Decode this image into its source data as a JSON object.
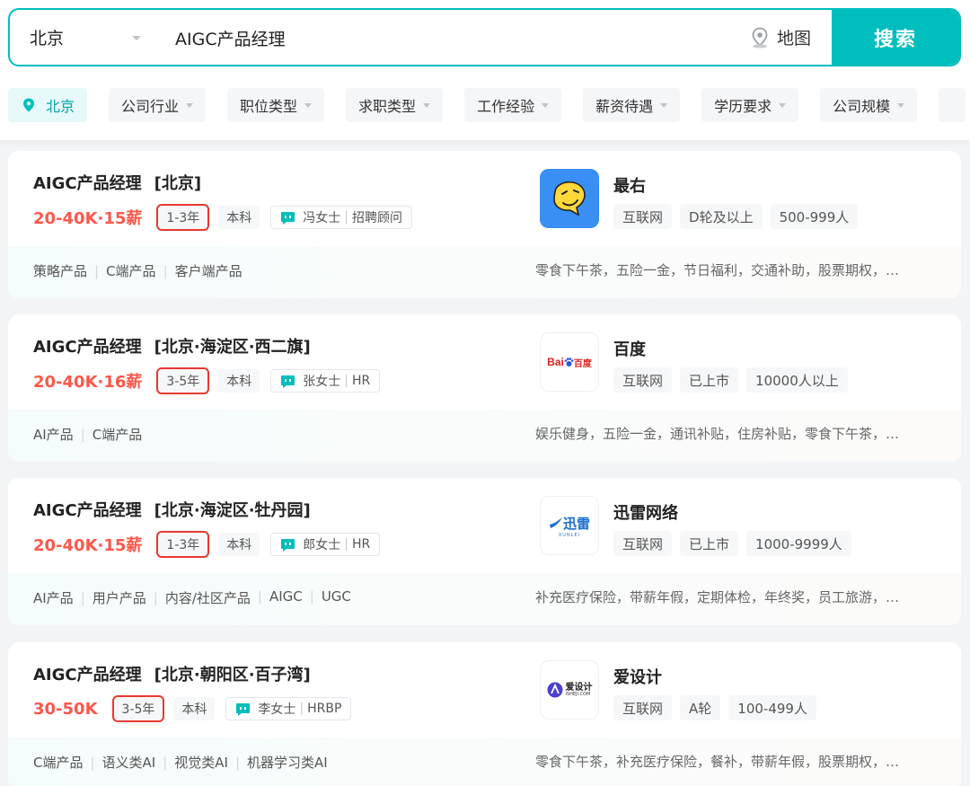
{
  "search": {
    "city": "北京",
    "query": "AIGC产品经理",
    "map_label": "地图",
    "search_button": "搜索"
  },
  "filters": {
    "city": "北京",
    "items": [
      "公司行业",
      "职位类型",
      "求职类型",
      "工作经验",
      "薪资待遇",
      "学历要求",
      "公司规模"
    ]
  },
  "jobs": [
    {
      "title": "AIGC产品经理",
      "location": "[北京]",
      "salary": "20-40K·15薪",
      "experience": "1-3年",
      "education": "本科",
      "recruiter": "冯女士",
      "recruiter_role": "招聘顾问",
      "company": "最右",
      "company_tags": [
        "互联网",
        "D轮及以上",
        "500-999人"
      ],
      "skills": [
        "策略产品",
        "C端产品",
        "客户端产品"
      ],
      "benefits": "零食下午茶，五险一金，节日福利，交通补助，股票期权，…",
      "logo": "zuiyou-logo"
    },
    {
      "title": "AIGC产品经理",
      "location": "[北京·海淀区·西二旗]",
      "salary": "20-40K·16薪",
      "experience": "3-5年",
      "education": "本科",
      "recruiter": "张女士",
      "recruiter_role": "HR",
      "company": "百度",
      "company_tags": [
        "互联网",
        "已上市",
        "10000人以上"
      ],
      "skills": [
        "AI产品",
        "C端产品"
      ],
      "benefits": "娱乐健身，五险一金，通讯补贴，住房补贴，零食下午茶，…",
      "logo": "baidu-logo",
      "logo_text": [
        "Bai",
        "百度"
      ]
    },
    {
      "title": "AIGC产品经理",
      "location": "[北京·海淀区·牡丹园]",
      "salary": "20-40K·15薪",
      "experience": "1-3年",
      "education": "本科",
      "recruiter": "郎女士",
      "recruiter_role": "HR",
      "company": "迅雷网络",
      "company_tags": [
        "互联网",
        "已上市",
        "1000-9999人"
      ],
      "skills": [
        "AI产品",
        "用户产品",
        "内容/社区产品",
        "AIGC",
        "UGC"
      ],
      "benefits": "补充医疗保险，带薪年假，定期体检，年终奖，员工旅游，…",
      "logo": "xunlei-logo",
      "logo_text": [
        "迅雷",
        "XUNLEI"
      ]
    },
    {
      "title": "AIGC产品经理",
      "location": "[北京·朝阳区·百子湾]",
      "salary": "30-50K",
      "experience": "3-5年",
      "education": "本科",
      "recruiter": "李女士",
      "recruiter_role": "HRBP",
      "company": "爱设计",
      "company_tags": [
        "互联网",
        "A轮",
        "100-499人"
      ],
      "skills": [
        "C端产品",
        "语义类AI",
        "视觉类AI",
        "机器学习类AI"
      ],
      "benefits": "零食下午茶，补充医疗保险，餐补，带薪年假，股票期权，…",
      "logo": "aisheji-logo",
      "logo_text": [
        "爱设计",
        "iSHEJI.COM"
      ]
    }
  ],
  "colors": {
    "accent": "#00bebd",
    "salary": "#fe574a",
    "highlight_box": "#e8392e"
  }
}
